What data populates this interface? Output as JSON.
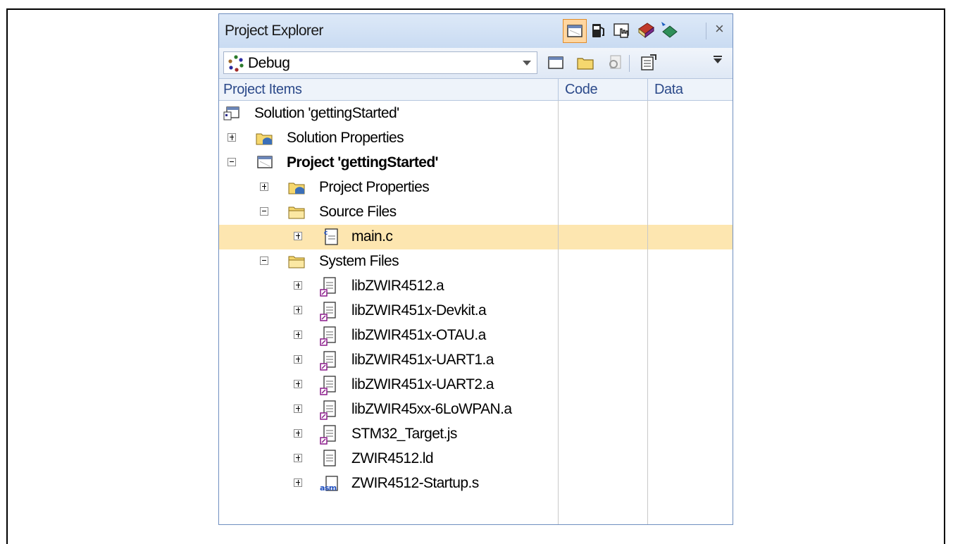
{
  "panel": {
    "title": "Project Explorer",
    "close_label": "×",
    "title_icons": [
      "window-icon",
      "fuel-pump-icon",
      "hand-cursor-icon",
      "book-icon",
      "chip-icon"
    ],
    "configuration": {
      "selected": "Debug"
    },
    "toolbar_icons": [
      "show-all-icon",
      "open-folder-icon",
      "refresh-icon",
      "properties-icon"
    ]
  },
  "columns": {
    "items": "Project Items",
    "code": "Code",
    "data": "Data"
  },
  "tree": [
    {
      "label": "Solution 'gettingStarted'",
      "icon": "solution-icon",
      "expander": "none",
      "bold": false
    },
    {
      "label": "Solution Properties",
      "icon": "properties-folder-icon",
      "expander": "plus",
      "bold": false
    },
    {
      "label": "Project 'gettingStarted'",
      "icon": "project-icon",
      "expander": "minus",
      "bold": true
    },
    {
      "label": "Project Properties",
      "icon": "properties-folder-icon",
      "expander": "plus",
      "bold": false
    },
    {
      "label": "Source Files",
      "icon": "folder-icon",
      "expander": "minus",
      "bold": false
    },
    {
      "label": "main.c",
      "icon": "c-file-icon",
      "expander": "plus",
      "bold": false,
      "selected": true
    },
    {
      "label": "System Files",
      "icon": "folder-icon",
      "expander": "minus",
      "bold": false
    },
    {
      "label": "libZWIR4512.a",
      "icon": "library-file-icon",
      "expander": "plus",
      "bold": false
    },
    {
      "label": "libZWIR451x-Devkit.a",
      "icon": "library-file-icon",
      "expander": "plus",
      "bold": false
    },
    {
      "label": "libZWIR451x-OTAU.a",
      "icon": "library-file-icon",
      "expander": "plus",
      "bold": false
    },
    {
      "label": "libZWIR451x-UART1.a",
      "icon": "library-file-icon",
      "expander": "plus",
      "bold": false
    },
    {
      "label": "libZWIR451x-UART2.a",
      "icon": "library-file-icon",
      "expander": "plus",
      "bold": false
    },
    {
      "label": "libZWIR45xx-6LoWPAN.a",
      "icon": "library-file-icon",
      "expander": "plus",
      "bold": false
    },
    {
      "label": "STM32_Target.js",
      "icon": "library-file-icon",
      "expander": "plus",
      "bold": false
    },
    {
      "label": "ZWIR4512.ld",
      "icon": "text-file-icon",
      "expander": "plus",
      "bold": false
    },
    {
      "label": "ZWIR4512-Startup.s",
      "icon": "asm-file-icon",
      "expander": "plus",
      "bold": false
    }
  ],
  "colors": {
    "accent": "#6f8fc0",
    "selection": "#fde6b0",
    "header_text": "#2c4a8a"
  }
}
